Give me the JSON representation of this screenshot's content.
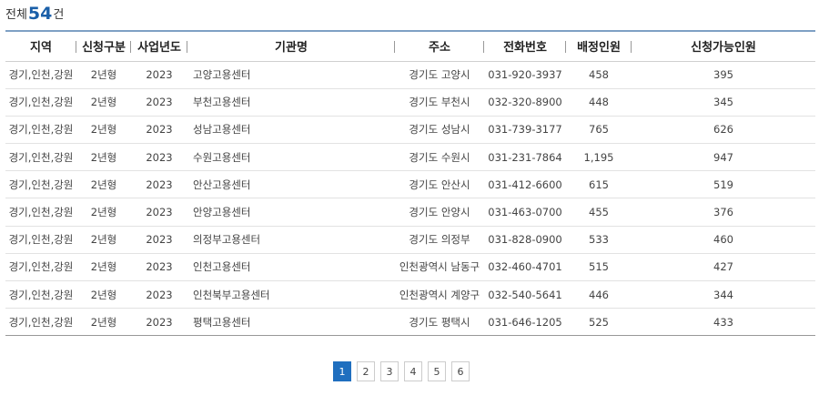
{
  "summary": {
    "prefix": "전체",
    "count": "54",
    "suffix": "건"
  },
  "columns": [
    "지역",
    "신청구분",
    "사업년도",
    "기관명",
    "주소",
    "전화번호",
    "배정인원",
    "신청가능인원"
  ],
  "rows": [
    [
      "경기,인천,강원",
      "2년형",
      "2023",
      "고양고용센터",
      "경기도 고양시",
      "031-920-3937",
      "458",
      "395"
    ],
    [
      "경기,인천,강원",
      "2년형",
      "2023",
      "부천고용센터",
      "경기도 부천시",
      "032-320-8900",
      "448",
      "345"
    ],
    [
      "경기,인천,강원",
      "2년형",
      "2023",
      "성남고용센터",
      "경기도 성남시",
      "031-739-3177",
      "765",
      "626"
    ],
    [
      "경기,인천,강원",
      "2년형",
      "2023",
      "수원고용센터",
      "경기도 수원시",
      "031-231-7864",
      "1,195",
      "947"
    ],
    [
      "경기,인천,강원",
      "2년형",
      "2023",
      "안산고용센터",
      "경기도 안산시",
      "031-412-6600",
      "615",
      "519"
    ],
    [
      "경기,인천,강원",
      "2년형",
      "2023",
      "안양고용센터",
      "경기도 안양시",
      "031-463-0700",
      "455",
      "376"
    ],
    [
      "경기,인천,강원",
      "2년형",
      "2023",
      "의정부고용센터",
      "경기도 의정부",
      "031-828-0900",
      "533",
      "460"
    ],
    [
      "경기,인천,강원",
      "2년형",
      "2023",
      "인천고용센터",
      "인천광역시 남동구",
      "032-460-4701",
      "515",
      "427"
    ],
    [
      "경기,인천,강원",
      "2년형",
      "2023",
      "인천북부고용센터",
      "인천광역시 계양구",
      "032-540-5641",
      "446",
      "344"
    ],
    [
      "경기,인천,강원",
      "2년형",
      "2023",
      "평택고용센터",
      "경기도 평택시",
      "031-646-1205",
      "525",
      "433"
    ]
  ],
  "pagination": {
    "pages": [
      "1",
      "2",
      "3",
      "4",
      "5",
      "6"
    ],
    "current": "1"
  },
  "colors": {
    "accent": "#1f6fbf",
    "count": "#1a5fa8",
    "header_border": "#7ea0c4"
  }
}
